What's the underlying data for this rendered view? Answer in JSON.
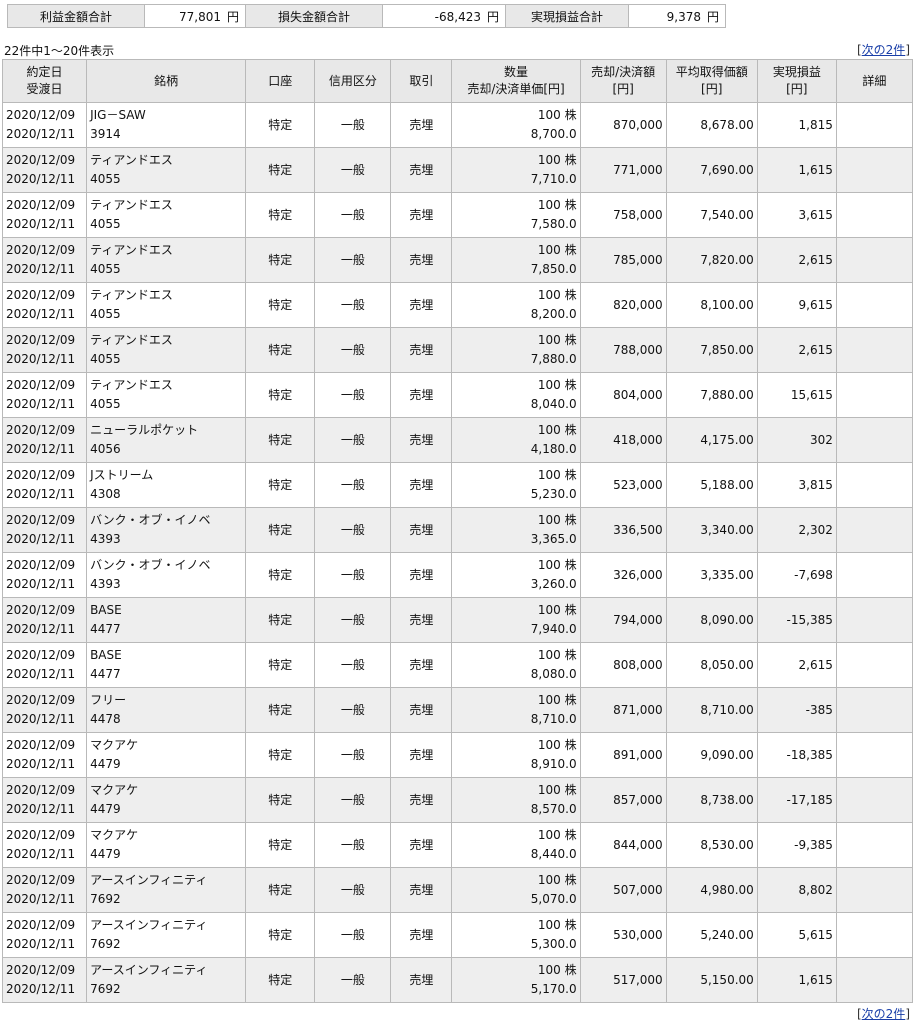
{
  "summary": {
    "profit_label": "利益金額合計",
    "profit_value": "77,801",
    "loss_label": "損失金額合計",
    "loss_value": "-68,423",
    "realized_label": "実現損益合計",
    "realized_value": "9,378",
    "unit": "円"
  },
  "count_text": "22件中1～20件表示",
  "next": {
    "open": "[",
    "label": "次の2件",
    "close": "]"
  },
  "headers": {
    "date": [
      "約定日",
      "受渡日"
    ],
    "name": "銘柄",
    "account": "口座",
    "credit": "信用区分",
    "trade": "取引",
    "qty": [
      "数量",
      "売却/決済単価[円]"
    ],
    "amount": [
      "売却/決済額",
      "[円]"
    ],
    "avg": [
      "平均取得価額",
      "[円]"
    ],
    "pl": [
      "実現損益",
      "[円]"
    ],
    "detail": "詳細"
  },
  "rows": [
    {
      "trade_date": "2020/12/09",
      "settle_date": "2020/12/11",
      "name": "JIG－SAW",
      "code": "3914",
      "account": "特定",
      "credit": "一般",
      "trade": "売埋",
      "qty": "100 株",
      "price": "8,700.0",
      "amount": "870,000",
      "avg": "8,678.00",
      "pl": "1,815"
    },
    {
      "trade_date": "2020/12/09",
      "settle_date": "2020/12/11",
      "name": "ティアンドエス",
      "code": "4055",
      "account": "特定",
      "credit": "一般",
      "trade": "売埋",
      "qty": "100 株",
      "price": "7,710.0",
      "amount": "771,000",
      "avg": "7,690.00",
      "pl": "1,615"
    },
    {
      "trade_date": "2020/12/09",
      "settle_date": "2020/12/11",
      "name": "ティアンドエス",
      "code": "4055",
      "account": "特定",
      "credit": "一般",
      "trade": "売埋",
      "qty": "100 株",
      "price": "7,580.0",
      "amount": "758,000",
      "avg": "7,540.00",
      "pl": "3,615"
    },
    {
      "trade_date": "2020/12/09",
      "settle_date": "2020/12/11",
      "name": "ティアンドエス",
      "code": "4055",
      "account": "特定",
      "credit": "一般",
      "trade": "売埋",
      "qty": "100 株",
      "price": "7,850.0",
      "amount": "785,000",
      "avg": "7,820.00",
      "pl": "2,615"
    },
    {
      "trade_date": "2020/12/09",
      "settle_date": "2020/12/11",
      "name": "ティアンドエス",
      "code": "4055",
      "account": "特定",
      "credit": "一般",
      "trade": "売埋",
      "qty": "100 株",
      "price": "8,200.0",
      "amount": "820,000",
      "avg": "8,100.00",
      "pl": "9,615"
    },
    {
      "trade_date": "2020/12/09",
      "settle_date": "2020/12/11",
      "name": "ティアンドエス",
      "code": "4055",
      "account": "特定",
      "credit": "一般",
      "trade": "売埋",
      "qty": "100 株",
      "price": "7,880.0",
      "amount": "788,000",
      "avg": "7,850.00",
      "pl": "2,615"
    },
    {
      "trade_date": "2020/12/09",
      "settle_date": "2020/12/11",
      "name": "ティアンドエス",
      "code": "4055",
      "account": "特定",
      "credit": "一般",
      "trade": "売埋",
      "qty": "100 株",
      "price": "8,040.0",
      "amount": "804,000",
      "avg": "7,880.00",
      "pl": "15,615"
    },
    {
      "trade_date": "2020/12/09",
      "settle_date": "2020/12/11",
      "name": "ニューラルポケット",
      "code": "4056",
      "account": "特定",
      "credit": "一般",
      "trade": "売埋",
      "qty": "100 株",
      "price": "4,180.0",
      "amount": "418,000",
      "avg": "4,175.00",
      "pl": "302"
    },
    {
      "trade_date": "2020/12/09",
      "settle_date": "2020/12/11",
      "name": "Jストリーム",
      "code": "4308",
      "account": "特定",
      "credit": "一般",
      "trade": "売埋",
      "qty": "100 株",
      "price": "5,230.0",
      "amount": "523,000",
      "avg": "5,188.00",
      "pl": "3,815"
    },
    {
      "trade_date": "2020/12/09",
      "settle_date": "2020/12/11",
      "name": "バンク・オブ・イノベ",
      "code": "4393",
      "account": "特定",
      "credit": "一般",
      "trade": "売埋",
      "qty": "100 株",
      "price": "3,365.0",
      "amount": "336,500",
      "avg": "3,340.00",
      "pl": "2,302"
    },
    {
      "trade_date": "2020/12/09",
      "settle_date": "2020/12/11",
      "name": "バンク・オブ・イノベ",
      "code": "4393",
      "account": "特定",
      "credit": "一般",
      "trade": "売埋",
      "qty": "100 株",
      "price": "3,260.0",
      "amount": "326,000",
      "avg": "3,335.00",
      "pl": "-7,698"
    },
    {
      "trade_date": "2020/12/09",
      "settle_date": "2020/12/11",
      "name": "BASE",
      "code": "4477",
      "account": "特定",
      "credit": "一般",
      "trade": "売埋",
      "qty": "100 株",
      "price": "7,940.0",
      "amount": "794,000",
      "avg": "8,090.00",
      "pl": "-15,385"
    },
    {
      "trade_date": "2020/12/09",
      "settle_date": "2020/12/11",
      "name": "BASE",
      "code": "4477",
      "account": "特定",
      "credit": "一般",
      "trade": "売埋",
      "qty": "100 株",
      "price": "8,080.0",
      "amount": "808,000",
      "avg": "8,050.00",
      "pl": "2,615"
    },
    {
      "trade_date": "2020/12/09",
      "settle_date": "2020/12/11",
      "name": "フリー",
      "code": "4478",
      "account": "特定",
      "credit": "一般",
      "trade": "売埋",
      "qty": "100 株",
      "price": "8,710.0",
      "amount": "871,000",
      "avg": "8,710.00",
      "pl": "-385"
    },
    {
      "trade_date": "2020/12/09",
      "settle_date": "2020/12/11",
      "name": "マクアケ",
      "code": "4479",
      "account": "特定",
      "credit": "一般",
      "trade": "売埋",
      "qty": "100 株",
      "price": "8,910.0",
      "amount": "891,000",
      "avg": "9,090.00",
      "pl": "-18,385"
    },
    {
      "trade_date": "2020/12/09",
      "settle_date": "2020/12/11",
      "name": "マクアケ",
      "code": "4479",
      "account": "特定",
      "credit": "一般",
      "trade": "売埋",
      "qty": "100 株",
      "price": "8,570.0",
      "amount": "857,000",
      "avg": "8,738.00",
      "pl": "-17,185"
    },
    {
      "trade_date": "2020/12/09",
      "settle_date": "2020/12/11",
      "name": "マクアケ",
      "code": "4479",
      "account": "特定",
      "credit": "一般",
      "trade": "売埋",
      "qty": "100 株",
      "price": "8,440.0",
      "amount": "844,000",
      "avg": "8,530.00",
      "pl": "-9,385"
    },
    {
      "trade_date": "2020/12/09",
      "settle_date": "2020/12/11",
      "name": "アースインフィニティ",
      "code": "7692",
      "account": "特定",
      "credit": "一般",
      "trade": "売埋",
      "qty": "100 株",
      "price": "5,070.0",
      "amount": "507,000",
      "avg": "4,980.00",
      "pl": "8,802"
    },
    {
      "trade_date": "2020/12/09",
      "settle_date": "2020/12/11",
      "name": "アースインフィニティ",
      "code": "7692",
      "account": "特定",
      "credit": "一般",
      "trade": "売埋",
      "qty": "100 株",
      "price": "5,300.0",
      "amount": "530,000",
      "avg": "5,240.00",
      "pl": "5,615"
    },
    {
      "trade_date": "2020/12/09",
      "settle_date": "2020/12/11",
      "name": "アースインフィニティ",
      "code": "7692",
      "account": "特定",
      "credit": "一般",
      "trade": "売埋",
      "qty": "100 株",
      "price": "5,170.0",
      "amount": "517,000",
      "avg": "5,150.00",
      "pl": "1,615"
    }
  ]
}
